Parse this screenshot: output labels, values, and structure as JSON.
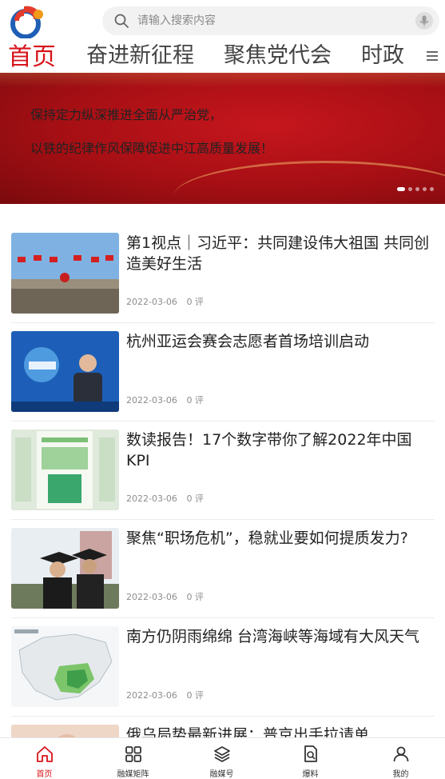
{
  "header": {
    "logo_icon": "app-logo-icon",
    "search": {
      "placeholder": "请输入搜索内容",
      "icon": "search-icon",
      "mic_icon": "microphone-icon"
    }
  },
  "tabs": [
    {
      "label": "首页",
      "active": true
    },
    {
      "label": "奋进新征程",
      "active": false
    },
    {
      "label": "聚焦党代会",
      "active": false
    },
    {
      "label": "时政",
      "active": false
    }
  ],
  "tab_menu_icon": "menu-icon",
  "banner": {
    "line1": "保持定力纵深推进全面从严治党，",
    "line2": "以铁的纪律作风保障促进中江高质量发展！",
    "slide_count": 5,
    "active_slide": 1
  },
  "news": [
    {
      "title": "第1视点｜习近平：共同建设伟大祖国 共同创造美好生活",
      "date": "2022-03-06",
      "comments": "0 评"
    },
    {
      "title": "杭州亚运会赛会志愿者首场培训启动",
      "date": "2022-03-06",
      "comments": "0 评"
    },
    {
      "title": "数读报告！17个数字带你了解2022年中国KPI",
      "date": "2022-03-06",
      "comments": "0 评"
    },
    {
      "title": "聚焦“职场危机”，稳就业要如何提质发力?",
      "date": "2022-03-06",
      "comments": "0 评"
    },
    {
      "title": "南方仍阴雨绵绵 台湾海峡等海域有大风天气",
      "date": "2022-03-06",
      "comments": "0 评"
    },
    {
      "title": "俄乌局势最新进展：普京出手拉请单",
      "date": "",
      "comments": ""
    }
  ],
  "bottom_nav": [
    {
      "label": "首页",
      "icon": "home-icon",
      "active": true
    },
    {
      "label": "融媒矩阵",
      "icon": "grid-icon",
      "active": false
    },
    {
      "label": "融媒号",
      "icon": "layers-icon",
      "active": false
    },
    {
      "label": "爆料",
      "icon": "document-search-icon",
      "active": false
    },
    {
      "label": "我的",
      "icon": "user-icon",
      "active": false
    }
  ],
  "colors": {
    "accent": "#d7141b",
    "banner_red": "#a50f14",
    "banner_text": "#ffd77a"
  }
}
